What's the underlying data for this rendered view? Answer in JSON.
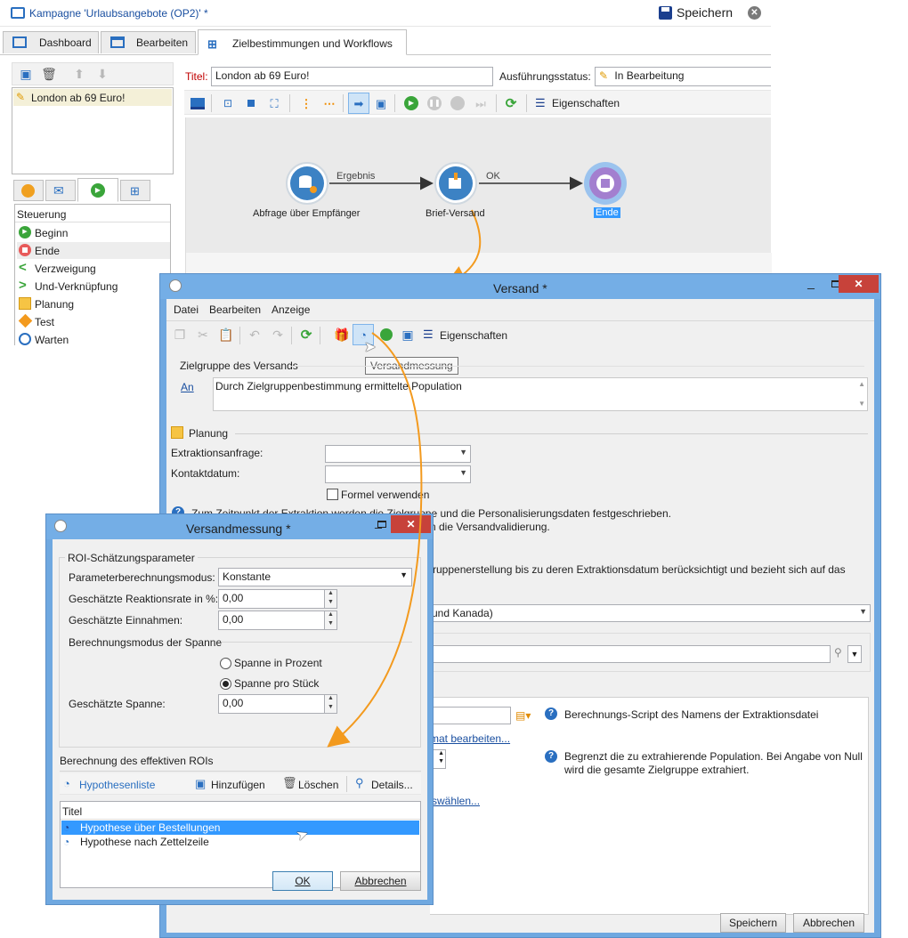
{
  "main_window": {
    "title": "Kampagne 'Urlaubsangebote (OP2)' *",
    "save_label": "Speichern",
    "tabs": [
      {
        "label": "Dashboard"
      },
      {
        "label": "Bearbeiten"
      },
      {
        "label": "Zielbestimmungen und Workflows"
      }
    ],
    "left_list": {
      "items": [
        {
          "label": "London ab 69 Euro!"
        }
      ]
    },
    "palette": {
      "header": "Steuerung",
      "items": [
        {
          "label": "Beginn",
          "icon": "play-circle-icon"
        },
        {
          "label": "Ende",
          "icon": "stop-circle-icon"
        },
        {
          "label": "Verzweigung",
          "icon": "fork-icon"
        },
        {
          "label": "Und-Verknüpfung",
          "icon": "join-icon"
        },
        {
          "label": "Planung",
          "icon": "calendar-icon"
        },
        {
          "label": "Test",
          "icon": "diamond-icon"
        },
        {
          "label": "Warten",
          "icon": "clock-icon"
        }
      ]
    },
    "title_label": "Titel:",
    "title_value": "London ab 69 Euro!",
    "status_label": "Ausführungsstatus:",
    "status_value": "In Bearbeitung",
    "properties_label": "Eigenschaften",
    "workflow": {
      "nodes": [
        {
          "label": "Abfrage über Empfänger"
        },
        {
          "label": "Brief-Versand"
        },
        {
          "label": "Ende"
        }
      ],
      "transitions": [
        {
          "label": "Ergebnis"
        },
        {
          "label": "OK"
        }
      ]
    }
  },
  "versand_dialog": {
    "title": "Versand *",
    "menu": [
      "Datei",
      "Bearbeiten",
      "Anzeige"
    ],
    "properties_label": "Eigenschaften",
    "tooltip": "Versandmessung",
    "target_group_label": "Zielgruppe des Versands",
    "an_link": "An",
    "target_text": "Durch Zielgruppenbestimmung ermittelte Population",
    "planning_label": "Planung",
    "extraction_label": "Extraktionsanfrage:",
    "contact_label": "Kontaktdatum:",
    "formula_label": "Formel verwenden",
    "info1_line1": "Zum Zeitpunkt der Extraktion werden die Zielgruppe und die Personalisierungsdaten festgeschrieben.",
    "info1_line2": "n die Versandvalidierung.",
    "info2": "ruppenerstellung bis zu deren Extraktionsdatum berücksichtigt und bezieht sich auf das",
    "timezone_value": "und Kanada)",
    "script_help": "Berechnungs-Script des Namens der Extraktionsdatei",
    "format_link": "mat bearbeiten...",
    "limit_help_line1": "Begrenzt die zu extrahierende Population. Bei Angabe von Null",
    "limit_help_line2": "wird die gesamte Zielgruppe extrahiert.",
    "select_link": "swählen...",
    "save_button": "Speichern",
    "cancel_button": "Abbrechen"
  },
  "measure_dialog": {
    "title": "Versandmessung *",
    "roi_group_label": "ROI-Schätzungsparameter",
    "mode_label": "Parameterberechnungsmodus:",
    "mode_value": "Konstante",
    "rate_label": "Geschätzte Reaktionsrate in %:",
    "rate_value": "0,00",
    "revenue_label": "Geschätzte Einnahmen:",
    "revenue_value": "0,00",
    "margin_mode_label": "Berechnungsmodus der Spanne",
    "radio_percent": "Spanne in Prozent",
    "radio_unit": "Spanne pro Stück",
    "margin_label": "Geschätzte Spanne:",
    "margin_value": "0,00",
    "effective_roi_label": "Berechnung des effektiven ROIs",
    "hypotheses_label": "Hypothesenliste",
    "add_label": "Hinzufügen",
    "delete_label": "Löschen",
    "details_label": "Details...",
    "list_header": "Titel",
    "list_items": [
      {
        "label": "Hypothese über Bestellungen"
      },
      {
        "label": "Hypothese nach Zettelzeile"
      }
    ],
    "ok_button": "OK",
    "cancel_button": "Abbrechen"
  },
  "colors": {
    "accent_blue": "#3c82c4",
    "selection": "#3399ff",
    "orange_arrow": "#f39a1e",
    "dialog_frame": "#7eb4ea",
    "title_red": "#c00000"
  }
}
